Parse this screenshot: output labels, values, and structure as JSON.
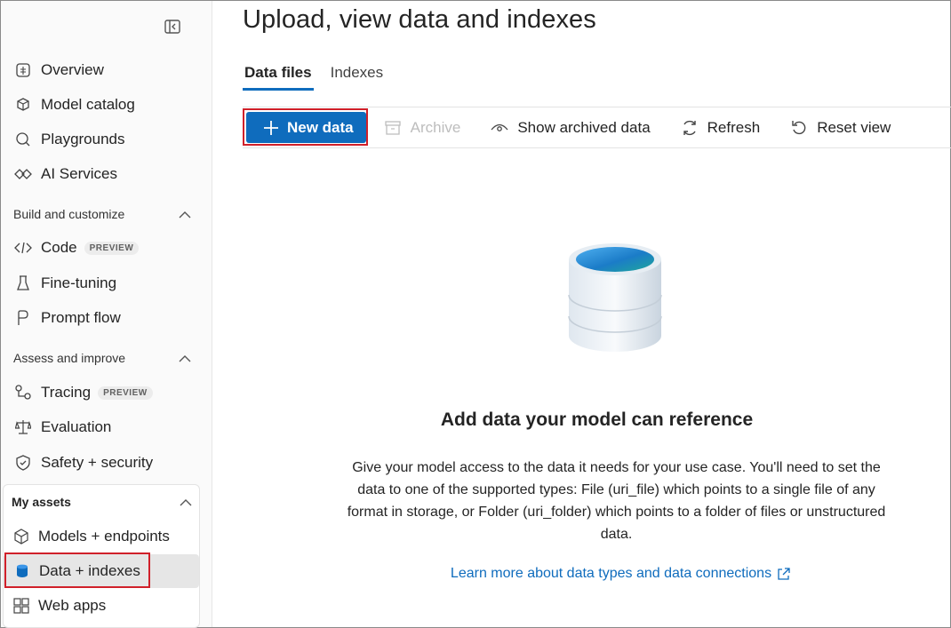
{
  "sidebar": {
    "collapse_icon": "sidebar-collapse-icon",
    "items_top": [
      {
        "label": "Overview",
        "icon": "grid-icon"
      },
      {
        "label": "Model catalog",
        "icon": "cube-stack-icon"
      },
      {
        "label": "Playgrounds",
        "icon": "chat-icon"
      },
      {
        "label": "AI Services",
        "icon": "diamond-link-icon"
      }
    ],
    "section_build": {
      "label": "Build and customize"
    },
    "items_build": [
      {
        "label": "Code",
        "badge": "PREVIEW",
        "icon": "code-icon"
      },
      {
        "label": "Fine-tuning",
        "icon": "flask-icon"
      },
      {
        "label": "Prompt flow",
        "icon": "flow-icon"
      }
    ],
    "section_assess": {
      "label": "Assess and improve"
    },
    "items_assess": [
      {
        "label": "Tracing",
        "badge": "PREVIEW",
        "icon": "tracing-icon"
      },
      {
        "label": "Evaluation",
        "icon": "scale-icon"
      },
      {
        "label": "Safety + security",
        "icon": "shield-icon"
      }
    ],
    "section_assets": {
      "label": "My assets"
    },
    "items_assets": [
      {
        "label": "Models + endpoints",
        "icon": "cube-icon"
      },
      {
        "label": "Data + indexes",
        "icon": "database-icon",
        "selected": true
      },
      {
        "label": "Web apps",
        "icon": "apps-icon"
      }
    ]
  },
  "main": {
    "title": "Upload, view data and indexes",
    "tabs": [
      {
        "label": "Data files",
        "active": true
      },
      {
        "label": "Indexes",
        "active": false
      }
    ],
    "toolbar": {
      "new_data": "New data",
      "archive": "Archive",
      "show_archived": "Show archived data",
      "refresh": "Refresh",
      "reset_view": "Reset view"
    },
    "empty_state": {
      "illustration": "database-illustration",
      "title": "Add data your model can reference",
      "description": "Give your model access to the data it needs for your use case. You'll need to set the data to one of the supported types: File (uri_file) which points to a single file of any format in storage, or Folder (uri_folder) which points to a folder of files or unstructured data.",
      "link": "Learn more about data types and data connections"
    }
  },
  "colors": {
    "accent": "#0f6cbd",
    "highlight_box": "#d0202a",
    "selected_bg": "#e6e6e6"
  }
}
